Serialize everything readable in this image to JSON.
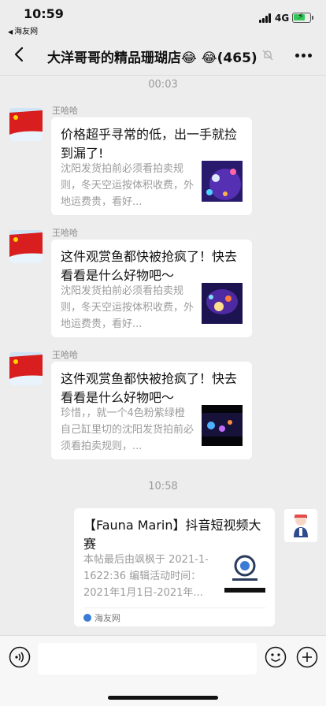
{
  "status_bar": {
    "time": "10:59",
    "back_label": "海友网",
    "network": "4G"
  },
  "nav": {
    "title": "大洋哥哥的精品珊瑚店😂 😂(465)"
  },
  "messages": [
    {
      "time": "00:03",
      "sender": "王哈哈",
      "title": "价格超乎寻常的低，出一手就捡到漏了!",
      "desc": "沈阳发货拍前必须看拍卖规则，冬天空运按体积收费，外地运费贵，看好..."
    },
    {
      "sender": "王哈哈",
      "title": "这件观赏鱼都快被抢疯了！快去看看是什么好物吧～",
      "desc": "沈阳发货拍前必须看拍卖规则，冬天空运按体积收费，外地运费贵，看好..."
    },
    {
      "sender": "王哈哈",
      "title": "这件观赏鱼都快被抢疯了！快去看看是什么好物吧～",
      "desc": "珍惜，，就一个4色粉紫绿橙自己缸里切的沈阳发货拍前必须看拍卖规则，..."
    },
    {
      "time": "10:58",
      "title": "【Fauna Marin】抖音短视频大赛",
      "desc": "本帖最后由飒枫于 2021-1-1622:36 编辑活动时间：2021年1月1日-2021年...",
      "source": "海友网"
    }
  ],
  "colors": {
    "background": "#ededed",
    "card": "#ffffff",
    "battery": "#34c759"
  }
}
